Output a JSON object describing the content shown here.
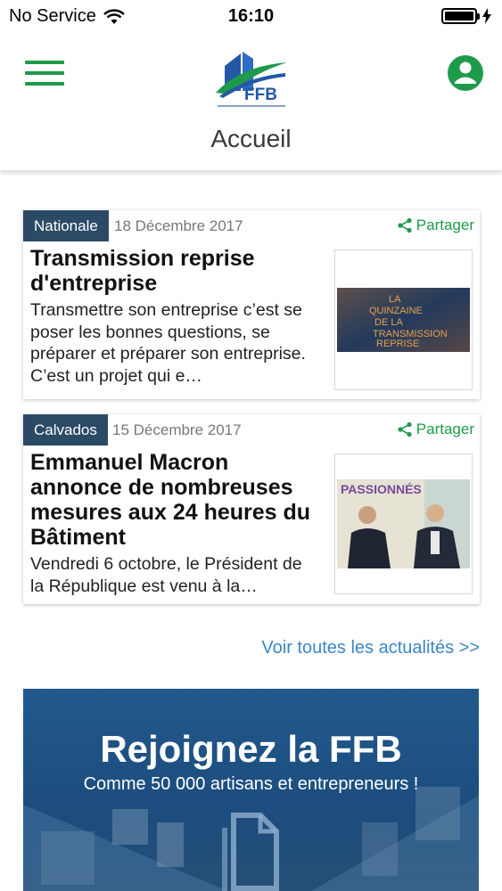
{
  "status_bar": {
    "carrier": "No Service",
    "time": "16:10"
  },
  "header": {
    "title": "Accueil",
    "logo_text": "FFB"
  },
  "articles": [
    {
      "tag": "Nationale",
      "date": "18 Décembre 2017",
      "share": "Partager",
      "title": "Transmission reprise d'entreprise",
      "excerpt": "Transmettre son entreprise c’est se poser les bonnes questions, se préparer et préparer son entreprise. C’est un projet qui e…",
      "image_text": {
        "line1": "LA",
        "line2": "QUINZAINE",
        "line3": "DE LA",
        "line4": "TRANSMISSION",
        "line5": "REPRISE"
      }
    },
    {
      "tag": "Calvados",
      "date": "15 Décembre 2017",
      "share": "Partager",
      "title": "Emmanuel Macron annonce de nombreuses mesures aux 24 heures du Bâtiment",
      "excerpt": "Vendredi 6 octobre, le Président de la République est venu à la…",
      "image_text": {
        "line1": "PASSIONNÉS"
      }
    }
  ],
  "see_all": "Voir toutes les actualités >>",
  "join": {
    "title": "Rejoignez la FFB",
    "subtitle": "Comme 50 000 artisans et entrepreneurs !"
  },
  "colors": {
    "green": "#1f9a4a",
    "tag_bg": "#2b4a66",
    "link": "#3a86c8",
    "banner": "#1f5487"
  }
}
